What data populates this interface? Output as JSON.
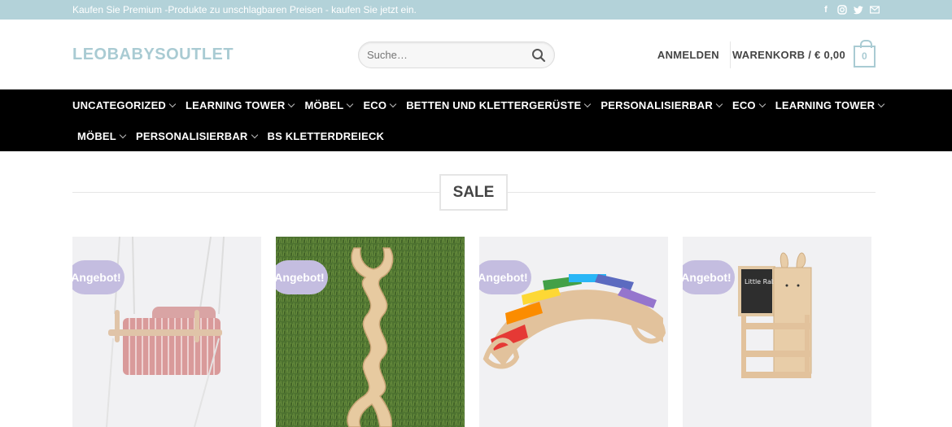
{
  "topbar": {
    "message": "Kaufen Sie Premium -Produkte zu unschlagbaren Preisen - kaufen Sie jetzt ein.",
    "social": [
      "facebook-icon",
      "instagram-icon",
      "twitter-icon",
      "email-icon"
    ]
  },
  "header": {
    "logo": "LEOBABYSOUTLET",
    "search_placeholder": "Suche…",
    "login_label": "ANMELDEN",
    "cart_label": "WARENKORB / € 0,00",
    "cart_count": "0"
  },
  "nav": {
    "row1": [
      {
        "label": "UNCATEGORIZED",
        "has_dropdown": true
      },
      {
        "label": "LEARNING TOWER",
        "has_dropdown": true
      },
      {
        "label": "MÖBEL",
        "has_dropdown": true
      },
      {
        "label": "ECO",
        "has_dropdown": true
      },
      {
        "label": "BETTEN UND KLETTERGERÜSTE",
        "has_dropdown": true
      },
      {
        "label": "PERSONALISIERBAR",
        "has_dropdown": true
      },
      {
        "label": "ECO",
        "has_dropdown": true
      },
      {
        "label": "LEARNING TOWER",
        "has_dropdown": true
      }
    ],
    "row2": [
      {
        "label": "MÖBEL",
        "has_dropdown": true
      },
      {
        "label": "PERSONALISIERBAR",
        "has_dropdown": true
      },
      {
        "label": "BS KLETTERDREIECK",
        "has_dropdown": false
      }
    ]
  },
  "section": {
    "title": "SALE"
  },
  "products": [
    {
      "badge": "Angebot!",
      "image": "baby-swing"
    },
    {
      "badge": "Angebot!",
      "image": "wooden-ramp-on-grass"
    },
    {
      "badge": "Angebot!",
      "image": "rainbow-climbing-arch"
    },
    {
      "badge": "Angebot!",
      "image": "learning-tower-rabbit",
      "chalk_text": "Little Rabbit"
    }
  ],
  "colors": {
    "topbar_bg": "#b3d2d9",
    "logo": "#a9cbd3",
    "nav_bg": "#000000",
    "badge_bg": "#c4bde0"
  }
}
